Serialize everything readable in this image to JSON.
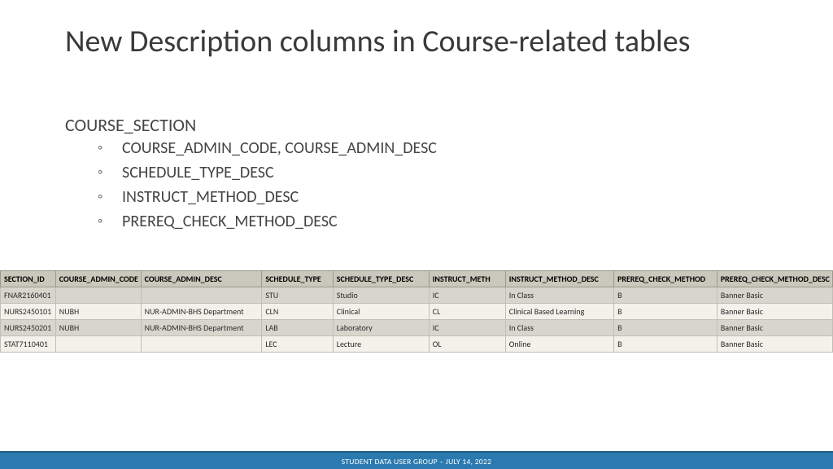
{
  "title": "New Description columns in Course-related tables",
  "section_head": "COURSE_SECTION",
  "bullets": [
    "COURSE_ADMIN_CODE, COURSE_ADMIN_DESC",
    "SCHEDULE_TYPE_DESC",
    "INSTRUCT_METHOD_DESC",
    "PREREQ_CHECK_METHOD_DESC"
  ],
  "table": {
    "headers": [
      "SECTION_ID",
      "COURSE_ADMIN_CODE",
      "COURSE_ADMIN_DESC",
      "SCHEDULE_TYPE",
      "SCHEDULE_TYPE_DESC",
      "INSTRUCT_METH",
      "INSTRUCT_METHOD_DESC",
      "PREREQ_CHECK_METHOD",
      "PREREQ_CHECK_METHOD_DESC"
    ],
    "rows": [
      [
        "FNAR2160401",
        "",
        "",
        "STU",
        "Studio",
        "IC",
        "In Class",
        "B",
        "Banner Basic"
      ],
      [
        "NURS2450101",
        "NUBH",
        "NUR-ADMIN-BHS Department",
        "CLN",
        "Clinical",
        "CL",
        "Clinical Based Learning",
        "B",
        "Banner Basic"
      ],
      [
        "NURS2450201",
        "NUBH",
        "NUR-ADMIN-BHS Department",
        "LAB",
        "Laboratory",
        "IC",
        "In Class",
        "B",
        "Banner Basic"
      ],
      [
        "STAT7110401",
        "",
        "",
        "LEC",
        "Lecture",
        "OL",
        "Online",
        "B",
        "Banner Basic"
      ]
    ]
  },
  "footer": "STUDENT DATA USER GROUP – JULY 14, 2022"
}
